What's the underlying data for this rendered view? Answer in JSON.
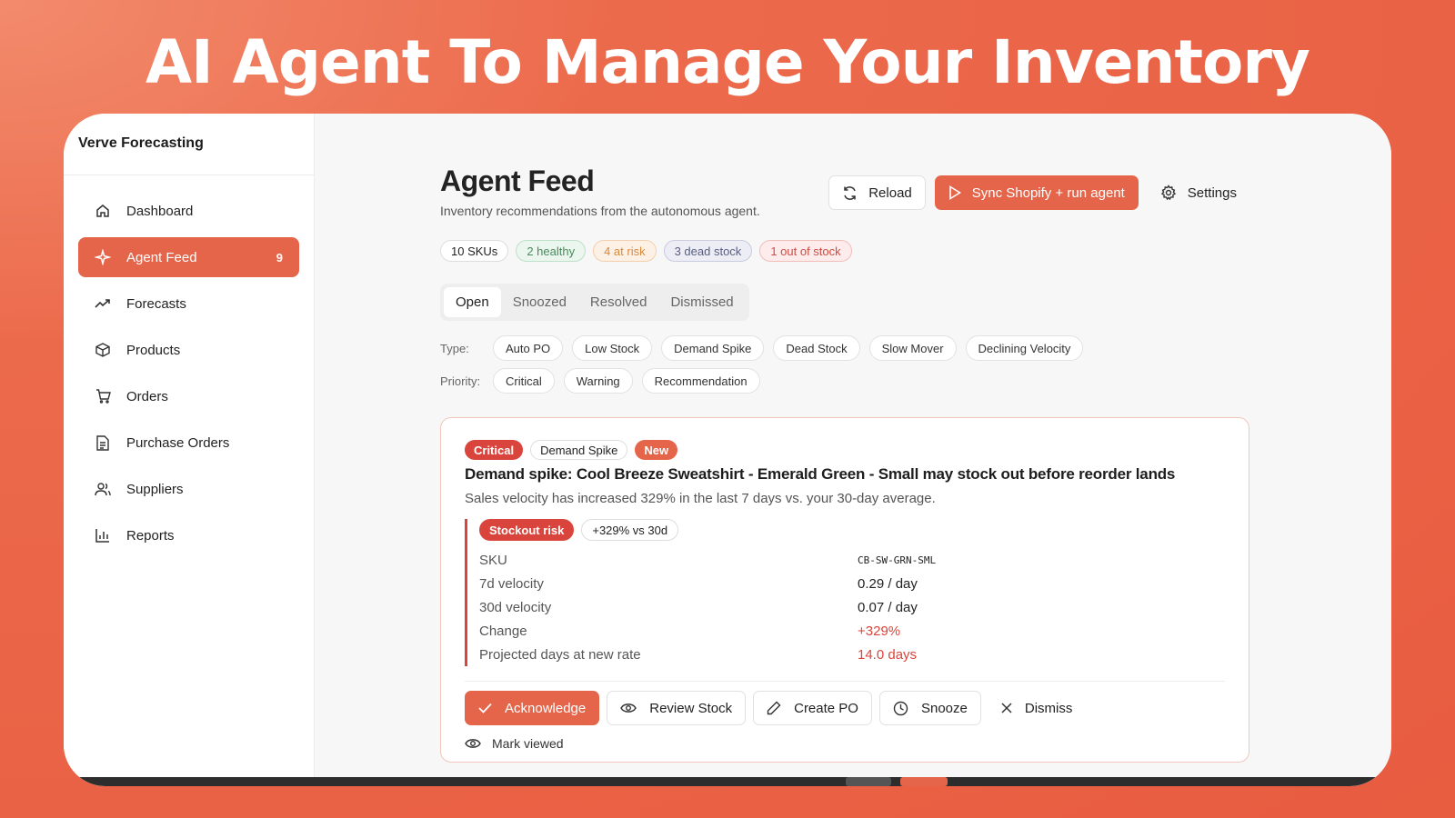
{
  "hero": {
    "title": "AI Agent To Manage Your Inventory"
  },
  "brand": "Verve Forecasting",
  "sidebar": {
    "items": [
      {
        "label": "Dashboard",
        "icon": "home-icon"
      },
      {
        "label": "Agent Feed",
        "icon": "sparkle-icon",
        "count": "9",
        "active": true
      },
      {
        "label": "Forecasts",
        "icon": "trend-up-icon"
      },
      {
        "label": "Products",
        "icon": "box-icon"
      },
      {
        "label": "Orders",
        "icon": "cart-icon"
      },
      {
        "label": "Purchase Orders",
        "icon": "document-icon"
      },
      {
        "label": "Suppliers",
        "icon": "users-icon"
      },
      {
        "label": "Reports",
        "icon": "bar-chart-icon"
      }
    ]
  },
  "header": {
    "title": "Agent Feed",
    "subtitle": "Inventory recommendations from the autonomous agent.",
    "reload_label": "Reload",
    "sync_label": "Sync Shopify + run agent",
    "settings_label": "Settings"
  },
  "stats": {
    "skus": "10 SKUs",
    "healthy": "2 healthy",
    "at_risk": "4 at risk",
    "dead_stock": "3 dead stock",
    "out_of_stock": "1 out of stock"
  },
  "tabs": [
    "Open",
    "Snoozed",
    "Resolved",
    "Dismissed"
  ],
  "filters": {
    "type_label": "Type:",
    "types": [
      "Auto PO",
      "Low Stock",
      "Demand Spike",
      "Dead Stock",
      "Slow Mover",
      "Declining Velocity"
    ],
    "priority_label": "Priority:",
    "priorities": [
      "Critical",
      "Warning",
      "Recommendation"
    ]
  },
  "card": {
    "tags": {
      "priority": "Critical",
      "type": "Demand Spike",
      "status": "New"
    },
    "title": "Demand spike: Cool Breeze Sweatshirt - Emerald Green - Small may stock out before reorder lands",
    "description": "Sales velocity has increased 329% in the last 7 days vs. your 30-day average.",
    "risk_tag": "Stockout risk",
    "change_tag": "+329% vs 30d",
    "details": [
      {
        "key": "SKU",
        "value": "CB-SW-GRN-SML"
      },
      {
        "key": "7d velocity",
        "value": "0.29 / day"
      },
      {
        "key": "30d velocity",
        "value": "0.07 / day"
      },
      {
        "key": "Change",
        "value": "+329%"
      },
      {
        "key": "Projected days at new rate",
        "value": "14.0 days"
      }
    ],
    "actions": {
      "acknowledge": "Acknowledge",
      "review": "Review Stock",
      "create_po": "Create PO",
      "snooze": "Snooze",
      "dismiss": "Dismiss",
      "mark_viewed": "Mark viewed"
    }
  },
  "colors": {
    "accent": "#e5654a",
    "critical": "#d9453c"
  }
}
